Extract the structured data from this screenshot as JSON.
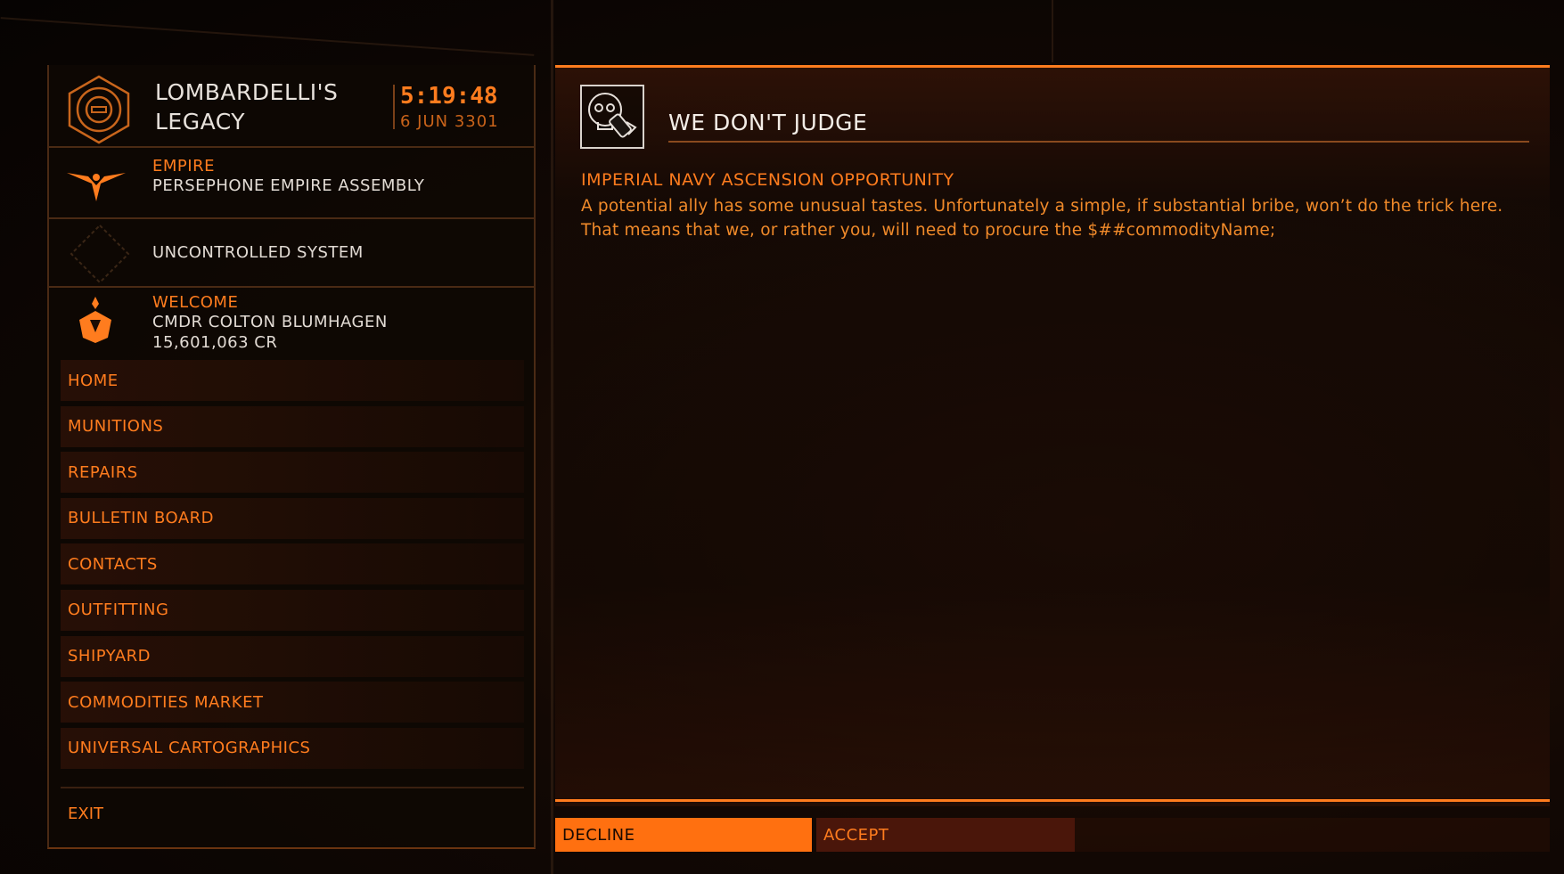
{
  "station": {
    "name": "LOMBARDELLI'S LEGACY",
    "time": "5:19:48",
    "date": "6 JUN 3301",
    "icon": "station-emblem-icon"
  },
  "faction": {
    "label": "EMPIRE",
    "name": "PERSEPHONE EMPIRE ASSEMBLY",
    "icon": "empire-eagle-icon"
  },
  "system": {
    "status": "UNCONTROLLED SYSTEM",
    "icon": "diamond-outline-icon"
  },
  "commander": {
    "label": "WELCOME",
    "name": "CMDR COLTON BLUMHAGEN",
    "credits": "15,601,063 CR",
    "icon": "commander-rank-icon"
  },
  "nav": {
    "items": [
      {
        "label": "HOME"
      },
      {
        "label": "MUNITIONS"
      },
      {
        "label": "REPAIRS"
      },
      {
        "label": "BULLETIN BOARD"
      },
      {
        "label": "CONTACTS"
      },
      {
        "label": "OUTFITTING"
      },
      {
        "label": "SHIPYARD"
      },
      {
        "label": "COMMODITIES MARKET"
      },
      {
        "label": "UNIVERSAL CARTOGRAPHICS"
      }
    ],
    "exit_label": "EXIT"
  },
  "mission": {
    "title": "WE DON'T JUDGE",
    "subtitle": "IMPERIAL NAVY ASCENSION OPPORTUNITY",
    "body_line1": "A potential ally has some unusual tastes. Unfortunately a simple, if substantial bribe, won’t do the trick here.",
    "body_line2": "That means that we, or rather you, will need to procure the $##commodityName;",
    "icon": "skull-canister-icon"
  },
  "actions": {
    "decline_label": "DECLINE",
    "accept_label": "ACCEPT"
  },
  "colors": {
    "accent": "#ff7c1e",
    "accent_dark": "#4a160a",
    "text_light": "#e8e2dc",
    "background": "#0a0503"
  }
}
